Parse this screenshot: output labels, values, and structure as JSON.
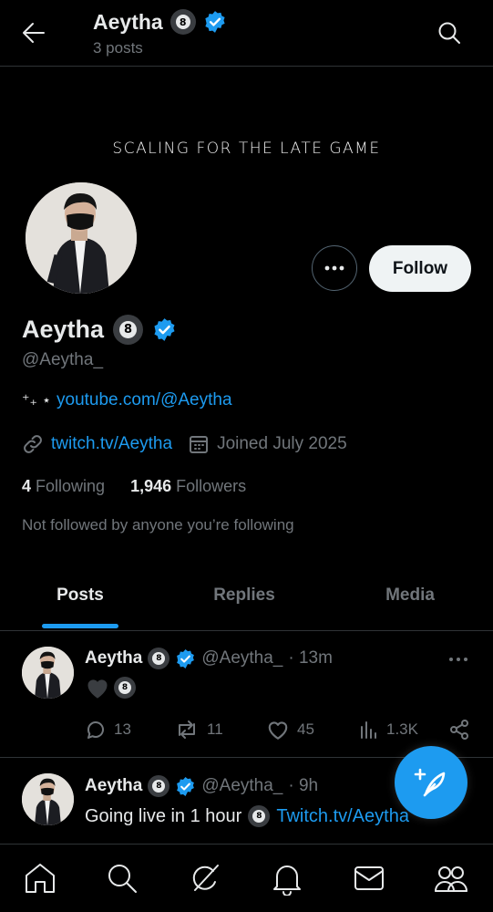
{
  "header": {
    "title": "Aeytha",
    "post_count": "3 posts",
    "milestone_badge": "8"
  },
  "banner": {
    "text": "SCALING FOR THE LATE GAME"
  },
  "profile": {
    "name": "Aeytha",
    "handle": "@Aeytha_",
    "milestone_badge": "8",
    "follow_label": "Follow",
    "bio_sparkle": "⁺₊ ⋆",
    "bio_link": "youtube.com/@Aeytha",
    "website": "twitch.tv/Aeytha",
    "joined": "Joined July 2025",
    "following_count": "4",
    "following_label": "Following",
    "followers_count": "1,946",
    "followers_label": "Followers",
    "followed_by": "Not followed by anyone you’re following"
  },
  "tabs": [
    {
      "label": "Posts",
      "active": true
    },
    {
      "label": "Replies",
      "active": false
    },
    {
      "label": "Media",
      "active": false
    }
  ],
  "posts": [
    {
      "name": "Aeytha",
      "badge": "8",
      "handle": "@Aeytha_",
      "time": "· 13m",
      "text_badge": "8",
      "replies": "13",
      "reposts": "11",
      "likes": "45",
      "views": "1.3K"
    },
    {
      "name": "Aeytha",
      "badge": "8",
      "handle": "@Aeytha_",
      "time": "· 9h",
      "text": "Going live in 1 hour",
      "text_badge": "8",
      "link": "Twitch.tv/Aeytha"
    }
  ],
  "colors": {
    "accent": "#1d9bf0",
    "background": "#000000",
    "text": "#e7e9ea",
    "muted": "#71767b",
    "divider": "#2f3336"
  }
}
